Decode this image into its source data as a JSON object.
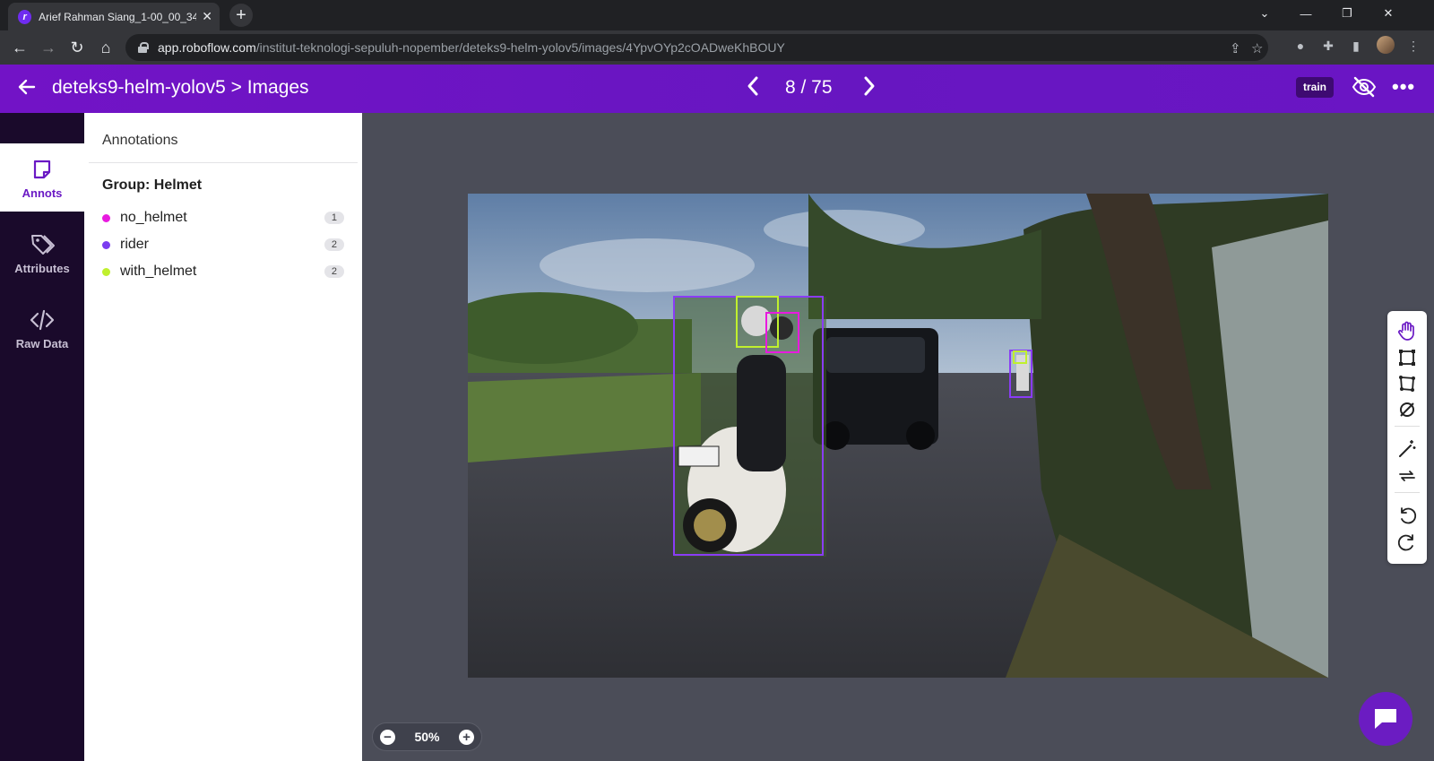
{
  "browser": {
    "tab_title": "Arief Rahman Siang_1-00_00_34_",
    "url_host": "app.roboflow.com",
    "url_path": "/institut-teknologi-sepuluh-nopember/deteks9-helm-yolov5/images/4YpvOYp2cOADweKhBOUY"
  },
  "header": {
    "title": "deteks9-helm-yolov5 > Images",
    "pager": "8 / 75",
    "split_badge": "train"
  },
  "nav": {
    "items": [
      {
        "label": "Annots",
        "icon": "sticky-note-icon",
        "active": true
      },
      {
        "label": "Attributes",
        "icon": "tags-icon",
        "active": false
      },
      {
        "label": "Raw Data",
        "icon": "code-icon",
        "active": false
      }
    ]
  },
  "panel": {
    "heading": "Annotations",
    "group_title": "Group: Helmet",
    "classes": [
      {
        "name": "no_helmet",
        "count": "1",
        "color": "#e81adf"
      },
      {
        "name": "rider",
        "count": "2",
        "color": "#7b3cf0"
      },
      {
        "name": "with_helmet",
        "count": "2",
        "color": "#c0f02e"
      }
    ]
  },
  "canvas": {
    "zoom": "50%"
  },
  "colors": {
    "brand": "#6a15c4",
    "rider_box": "#8a3cf6",
    "no_helmet_box": "#e81adf",
    "with_helmet_box": "#c0f02e"
  }
}
